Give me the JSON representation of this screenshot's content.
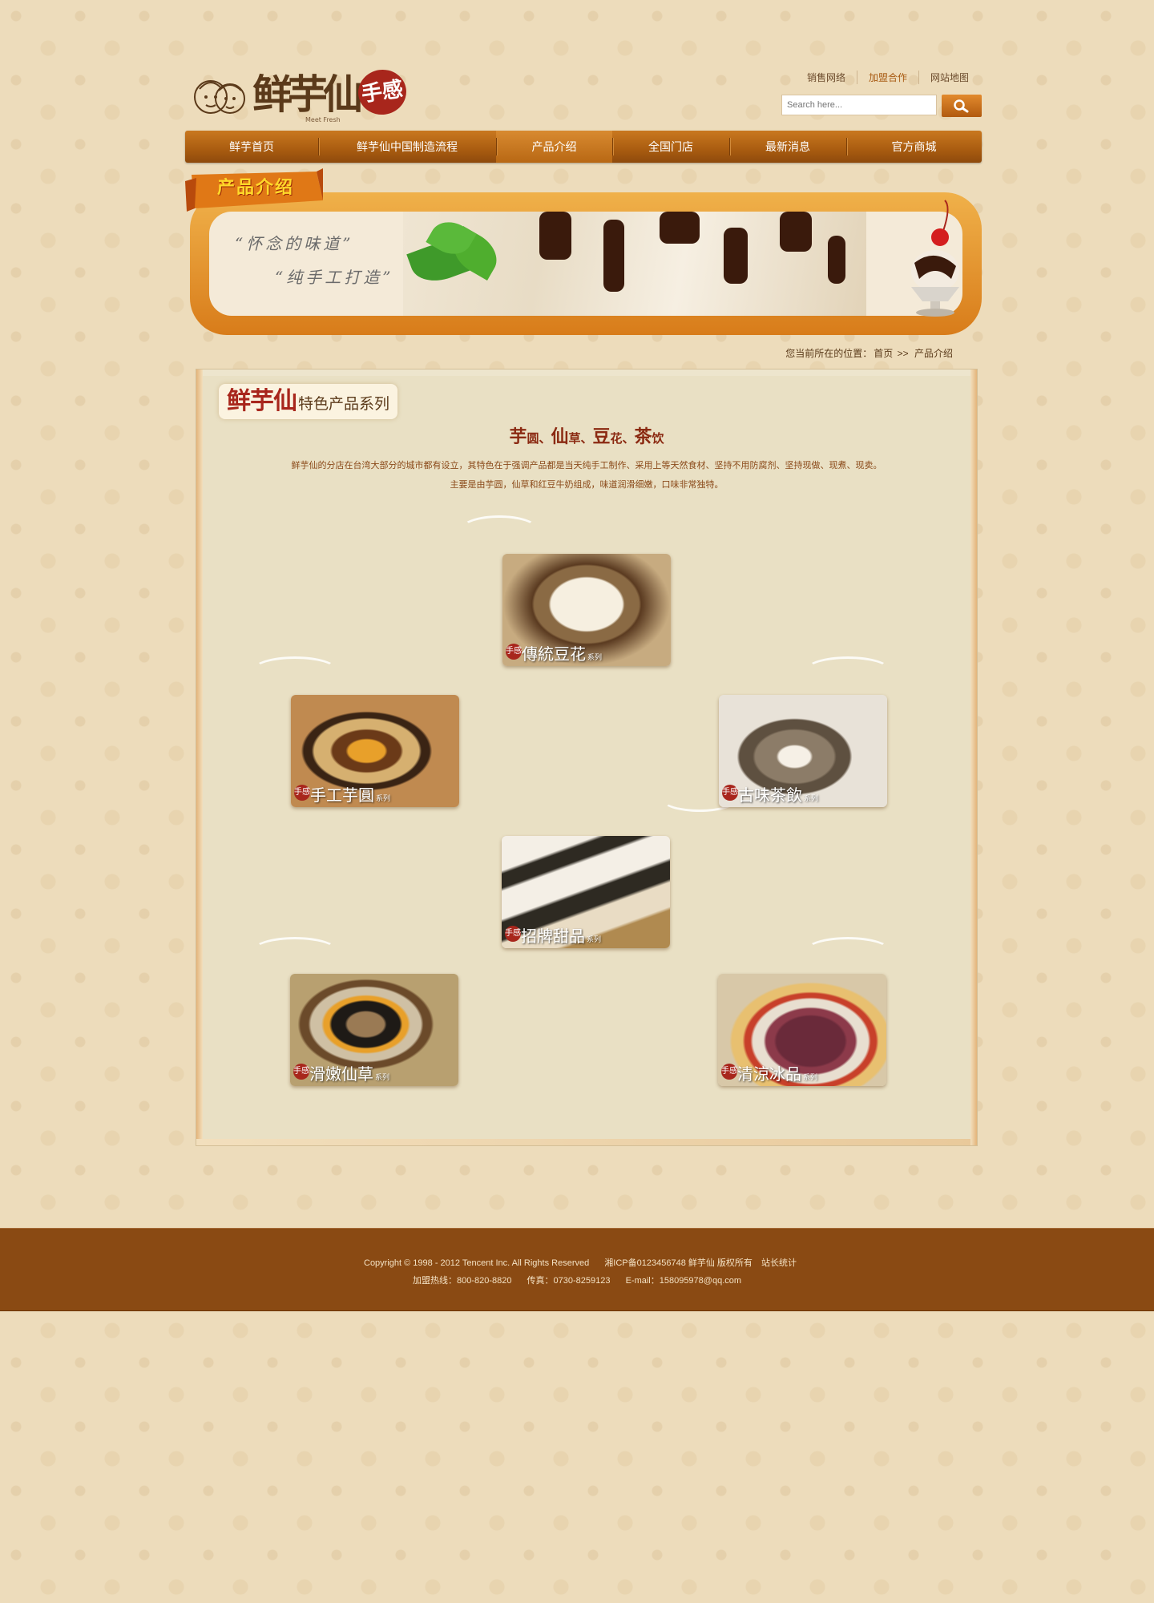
{
  "header": {
    "logo_text": "鲜芋仙",
    "logo_sub": "Meet Fresh",
    "logo_seal": "手感",
    "toplinks": [
      "销售网络",
      "加盟合作",
      "网站地图"
    ],
    "search_placeholder": "Search here..."
  },
  "nav": {
    "items": [
      "鲜芋首页",
      "鲜芋仙中国制造流程",
      "产品介绍",
      "全国门店",
      "最新消息",
      "官方商城"
    ],
    "active": "产品介绍"
  },
  "banner": {
    "ribbon": "产品介绍",
    "slogan1": "“怀念的味道”",
    "slogan2": "“纯手工打造”"
  },
  "breadcrumb": {
    "prefix": "您当前所在的位置：",
    "home": "首页",
    "sep": ">>",
    "current": "产品介绍"
  },
  "section": {
    "title_big": "鲜芋仙",
    "title_small": "特色产品系列",
    "sub": [
      {
        "b": "芋",
        "s": "圆、"
      },
      {
        "b": "仙",
        "s": "草、"
      },
      {
        "b": "豆",
        "s": "花、"
      },
      {
        "b": "茶",
        "s": "饮"
      }
    ],
    "desc1": "鲜芋仙的分店在台湾大部分的城市都有设立，其特色在于强调产品都是当天纯手工制作、采用上等天然食材、坚持不用防腐剂、坚持现做、现煮、现卖。",
    "desc2": "主要是由芋圆，仙草和红豆牛奶组成，味道润滑细嫩，口味非常独特。"
  },
  "products": [
    {
      "name": "傳統豆花",
      "suffix": "系列",
      "seal": "手感"
    },
    {
      "name": "手工芋圓",
      "suffix": "系列",
      "seal": "手感"
    },
    {
      "name": "古味茶飲",
      "suffix": "系列",
      "seal": "手感"
    },
    {
      "name": "招牌甜品",
      "suffix": "系列",
      "seal": "手感"
    },
    {
      "name": "滑嫩仙草",
      "suffix": "系列",
      "seal": "手感"
    },
    {
      "name": "清涼冰品",
      "suffix": "系列",
      "seal": "手感"
    }
  ],
  "footer": {
    "copyright": "Copyright © 1998 - 2012 Tencent Inc. All Rights Reserved",
    "icp": "湘ICP备0123456748 鲜芋仙 版权所有",
    "stats": "站长统计",
    "hotline": "加盟热线：800-820-8820",
    "fax": "传真：0730-8259123",
    "email": "E-mail：158095978@qq.com"
  },
  "colors": {
    "accent": "#a85a12",
    "nav": "#a95c10",
    "footer": "#8a4a13",
    "title_red": "#a8261c"
  }
}
